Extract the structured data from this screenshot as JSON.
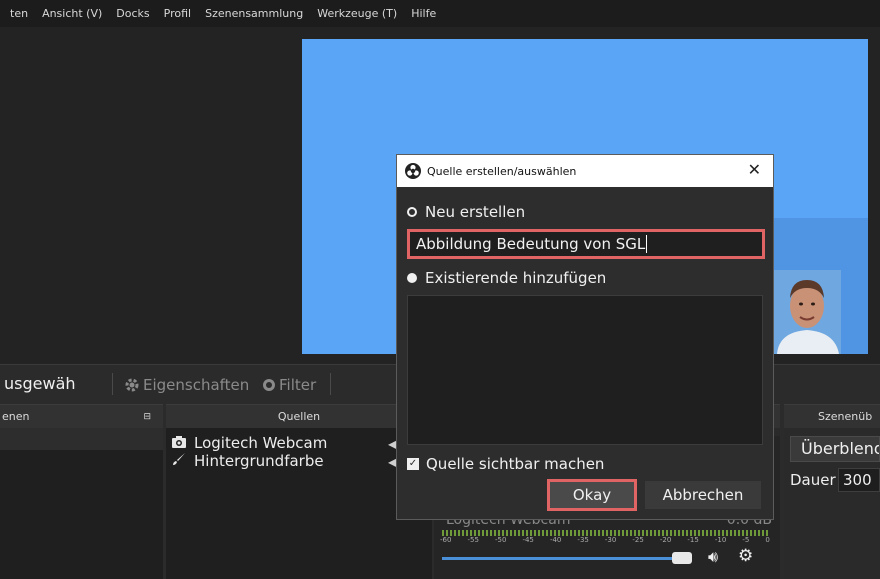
{
  "menu": [
    "ten",
    "Ansicht (V)",
    "Docks",
    "Profil",
    "Szenensammlung",
    "Werkzeuge (T)",
    "Hilfe"
  ],
  "toolbar": {
    "selection_label": "usgewäh",
    "properties_label": "Eigenschaften",
    "filter_label": "Filter"
  },
  "docks": {
    "scenes_title": "enen",
    "sources_title": "Quellen",
    "transitions_title": "Szenenüb"
  },
  "sources": [
    {
      "label": "Logitech Webcam",
      "icon": "camera-icon"
    },
    {
      "label": "Hintergrundfarbe",
      "icon": "brush-icon"
    }
  ],
  "mixer": {
    "source_label": "Logitech Webcam",
    "level": "0.0 dB",
    "ticks": [
      "-60",
      "-55",
      "-50",
      "-45",
      "-40",
      "-35",
      "-30",
      "-25",
      "-20",
      "-15",
      "-10",
      "-5",
      "0"
    ],
    "volume_fraction": 0.88
  },
  "transitions": {
    "selected": "Überblend",
    "duration_label": "Dauer",
    "duration_value": "300"
  },
  "dialog": {
    "title": "Quelle erstellen/auswählen",
    "option_new": "Neu erstellen",
    "name_value": "Abbildung Bedeutung von SGL",
    "option_existing": "Existierende hinzufügen",
    "visible_label": "Quelle sichtbar machen",
    "ok_label": "Okay",
    "cancel_label": "Abbrechen"
  },
  "colors": {
    "canvas": "#5aa5f5",
    "highlight": "#e06464"
  }
}
